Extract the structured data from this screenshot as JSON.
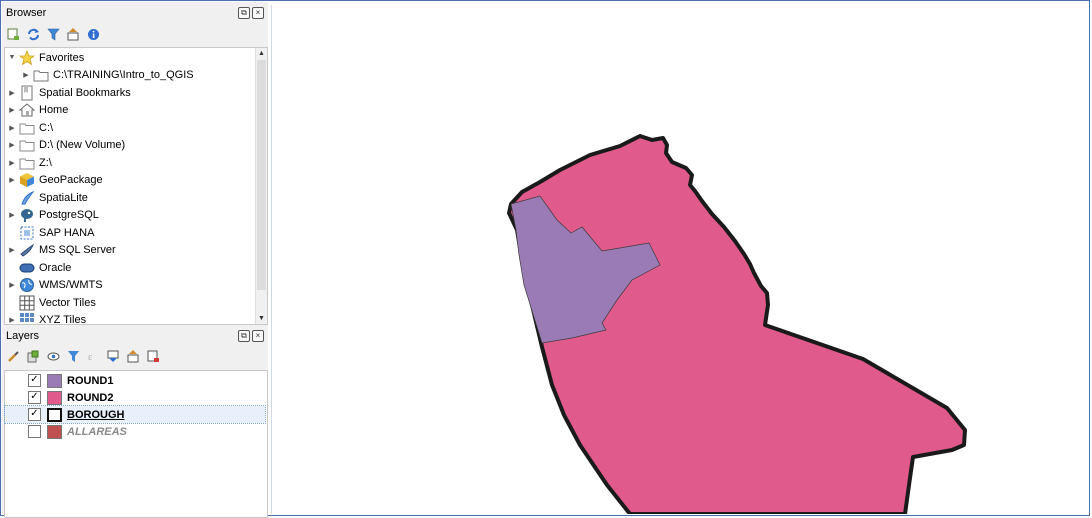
{
  "browser": {
    "title": "Browser",
    "toolbar_icons": [
      "add-selected-icon",
      "refresh-icon",
      "filter-icon",
      "collapse-all-icon",
      "info-icon"
    ],
    "items": [
      {
        "label": "Favorites",
        "icon": "star-icon",
        "expander": "open"
      },
      {
        "label": "C:\\TRAINING\\Intro_to_QGIS",
        "icon": "folder-icon",
        "expander": "closed",
        "indent": 1
      },
      {
        "label": "Spatial Bookmarks",
        "icon": "bookmark-icon",
        "expander": "closed"
      },
      {
        "label": "Home",
        "icon": "home-icon",
        "expander": "closed"
      },
      {
        "label": "C:\\",
        "icon": "drive-icon",
        "expander": "closed"
      },
      {
        "label": "D:\\ (New Volume)",
        "icon": "drive-icon",
        "expander": "closed"
      },
      {
        "label": "Z:\\",
        "icon": "drive-icon",
        "expander": "closed"
      },
      {
        "label": "GeoPackage",
        "icon": "geopackage-icon",
        "expander": "closed"
      },
      {
        "label": "SpatiaLite",
        "icon": "spatialite-icon",
        "expander": "none"
      },
      {
        "label": "PostgreSQL",
        "icon": "postgresql-icon",
        "expander": "closed"
      },
      {
        "label": "SAP HANA",
        "icon": "sap-hana-icon",
        "expander": "none"
      },
      {
        "label": "MS SQL Server",
        "icon": "mssql-icon",
        "expander": "closed"
      },
      {
        "label": "Oracle",
        "icon": "oracle-icon",
        "expander": "none"
      },
      {
        "label": "WMS/WMTS",
        "icon": "globe-icon",
        "expander": "closed"
      },
      {
        "label": "Vector Tiles",
        "icon": "vector-tiles-icon",
        "expander": "none"
      },
      {
        "label": "XYZ Tiles",
        "icon": "xyz-tiles-icon",
        "expander": "closed"
      }
    ]
  },
  "layers": {
    "title": "Layers",
    "toolbar_icons": [
      "style-brush-icon",
      "add-group-icon",
      "eye-icon",
      "filter-legend-icon",
      "expression-filter-icon",
      "expand-all-icon",
      "collapse-all-icon",
      "remove-layer-icon"
    ],
    "items": [
      {
        "name": "ROUND1",
        "checked": true,
        "color": "#9b7bb6",
        "style": "bold"
      },
      {
        "name": "ROUND2",
        "checked": true,
        "color": "#e05a8b",
        "style": "bold"
      },
      {
        "name": "BOROUGH",
        "checked": true,
        "color": "#ffffff",
        "style": "bold-underline-selected"
      },
      {
        "name": "ALLAREAS",
        "checked": false,
        "color": "#c0504d",
        "style": "bold-italic-gray"
      }
    ]
  },
  "map": {
    "borough_fill": "#e05a8b",
    "round1_fill": "#9b7bb6",
    "outline": "#1a1a1a"
  }
}
